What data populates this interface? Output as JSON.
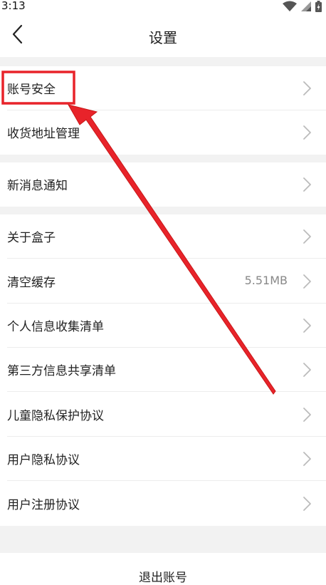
{
  "status_bar": {
    "time": "3:13"
  },
  "header": {
    "title": "设置"
  },
  "settings": {
    "group1": [
      {
        "label": "账号安全"
      },
      {
        "label": "收货地址管理"
      }
    ],
    "group2": [
      {
        "label": "新消息通知"
      }
    ],
    "group3": [
      {
        "label": "关于盒子"
      },
      {
        "label": "清空缓存",
        "value": "5.51MB"
      },
      {
        "label": "个人信息收集清单"
      },
      {
        "label": "第三方信息共享清单"
      },
      {
        "label": "儿童隐私保护协议"
      },
      {
        "label": "用户隐私协议"
      },
      {
        "label": "用户注册协议"
      }
    ]
  },
  "logout": {
    "label": "退出账号"
  },
  "annotation": {
    "highlight_color": "#e8232a"
  }
}
